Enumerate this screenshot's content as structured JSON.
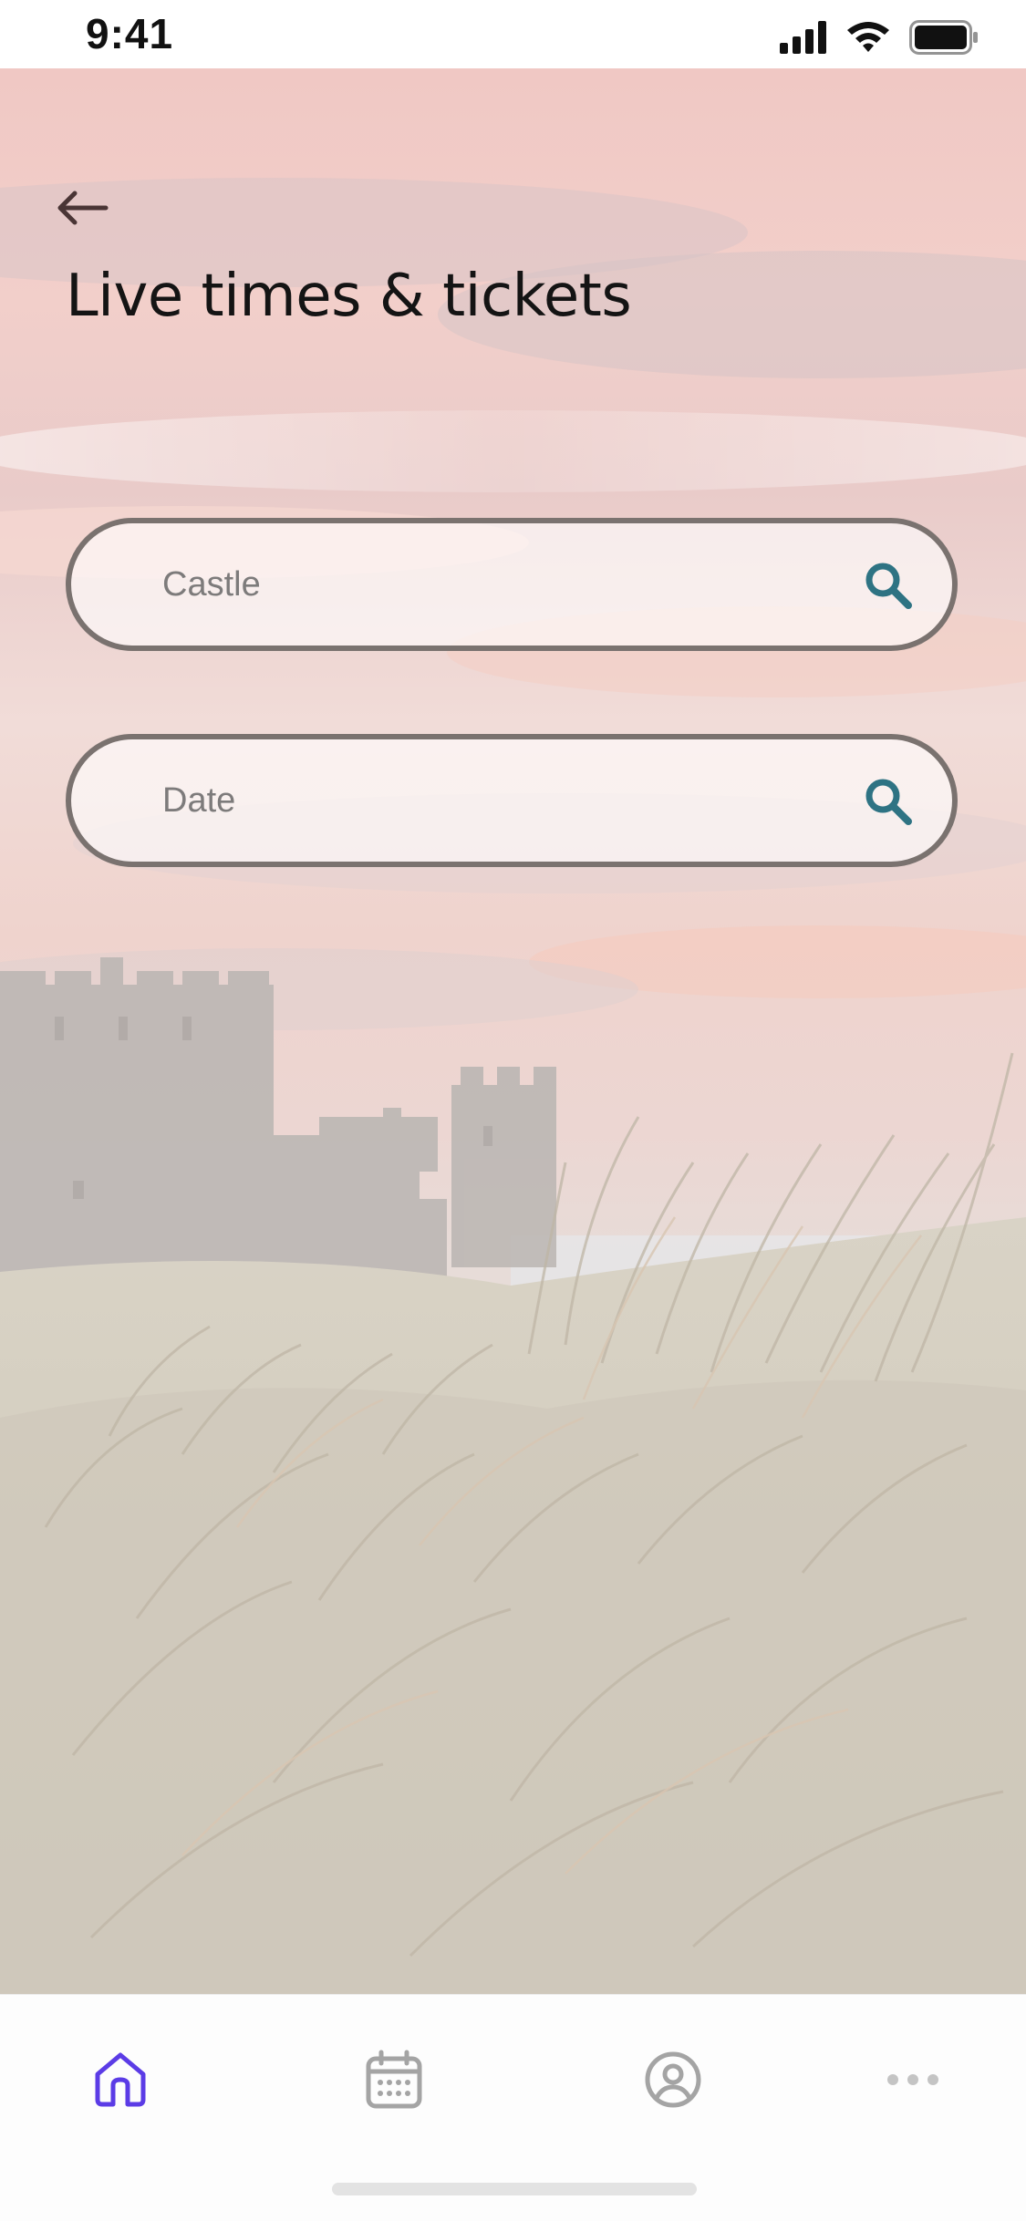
{
  "status_bar": {
    "time": "9:41",
    "icons": [
      "signal-icon",
      "wifi-icon",
      "battery-icon"
    ]
  },
  "header": {
    "back_icon": "arrow-left-icon",
    "title": "Live times & tickets"
  },
  "search": {
    "castle_placeholder": "Castle",
    "date_placeholder": "Date",
    "icon": "search-icon"
  },
  "tab_bar": {
    "items": [
      {
        "name": "home",
        "icon": "home-icon",
        "active": true
      },
      {
        "name": "calendar",
        "icon": "calendar-icon",
        "active": false
      },
      {
        "name": "profile",
        "icon": "profile-icon",
        "active": false
      },
      {
        "name": "more",
        "icon": "more-icon",
        "active": false
      }
    ]
  },
  "colors": {
    "accent": "#5b3ce6",
    "search_icon": "#2e7383",
    "inactive_icon": "#a4a4a4",
    "field_border": "#7a726f"
  }
}
